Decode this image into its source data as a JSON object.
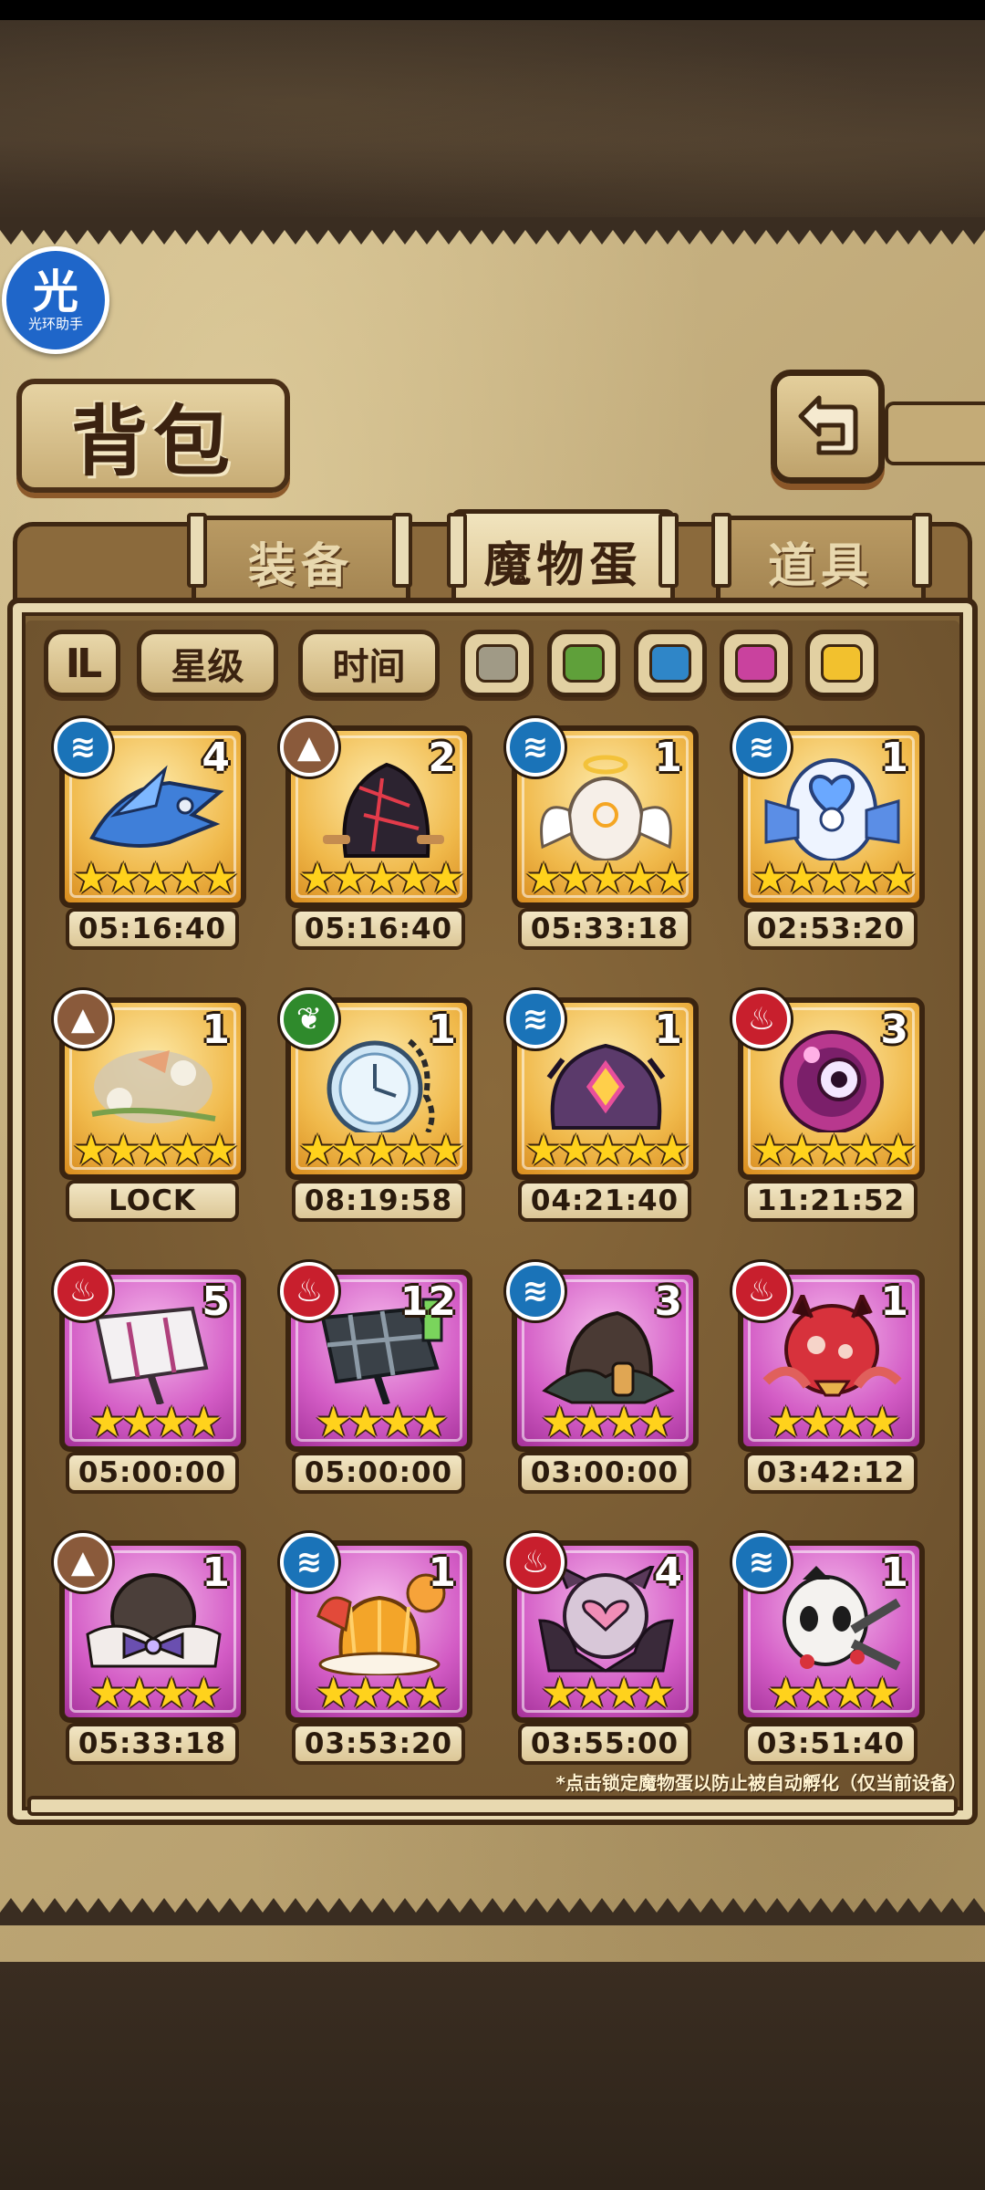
{
  "helper_badge": {
    "glyph": "光",
    "caption": "光环助手"
  },
  "header": {
    "title": "背包"
  },
  "tabs": [
    {
      "label": "装备",
      "active": false
    },
    {
      "label": "魔物蛋",
      "active": true
    },
    {
      "label": "道具",
      "active": false
    }
  ],
  "filters": {
    "sort_toggle_glyph": "IL",
    "star_label": "星级",
    "time_label": "时间",
    "color_swatches": [
      "#a09a86",
      "#5fa03a",
      "#2f86c8",
      "#c9429e",
      "#f2c12e"
    ]
  },
  "eggs": [
    {
      "element": "water",
      "count": "4",
      "stars": 5,
      "rarity": "gold",
      "timer": "05:16:40",
      "art": "blue-mecha-dragon"
    },
    {
      "element": "earth",
      "count": "2",
      "stars": 5,
      "rarity": "gold",
      "timer": "05:16:40",
      "art": "dark-hooded-egg"
    },
    {
      "element": "water",
      "count": "1",
      "stars": 5,
      "rarity": "gold",
      "timer": "05:33:18",
      "art": "winged-halo-egg"
    },
    {
      "element": "water",
      "count": "1",
      "stars": 5,
      "rarity": "gold",
      "timer": "02:53:20",
      "art": "heart-ribbon-egg"
    },
    {
      "element": "earth",
      "count": "1",
      "stars": 5,
      "rarity": "gold",
      "timer": "LOCK",
      "art": "flower-cloud-egg"
    },
    {
      "element": "wood",
      "count": "1",
      "stars": 5,
      "rarity": "gold",
      "timer": "08:19:58",
      "art": "pocket-watch-egg"
    },
    {
      "element": "water",
      "count": "1",
      "stars": 5,
      "rarity": "gold",
      "timer": "04:21:40",
      "art": "purple-eye-egg"
    },
    {
      "element": "fire",
      "count": "3",
      "stars": 5,
      "rarity": "gold",
      "timer": "11:21:52",
      "art": "pink-orb-egg"
    },
    {
      "element": "fire",
      "count": "5",
      "stars": 4,
      "rarity": "purple",
      "timer": "05:00:00",
      "art": "white-hammer-egg"
    },
    {
      "element": "fire",
      "count": "12",
      "stars": 4,
      "rarity": "purple",
      "timer": "05:00:00",
      "art": "plaid-hammer-egg"
    },
    {
      "element": "water",
      "count": "3",
      "stars": 4,
      "rarity": "purple",
      "timer": "03:00:00",
      "art": "brown-cloak-egg"
    },
    {
      "element": "fire",
      "count": "1",
      "stars": 4,
      "rarity": "purple",
      "timer": "03:42:12",
      "art": "red-octopus-egg"
    },
    {
      "element": "earth",
      "count": "1",
      "stars": 4,
      "rarity": "purple",
      "timer": "05:33:18",
      "art": "bow-tie-egg"
    },
    {
      "element": "water",
      "count": "1",
      "stars": 4,
      "rarity": "purple",
      "timer": "03:53:20",
      "art": "pudding-egg"
    },
    {
      "element": "fire",
      "count": "4",
      "stars": 4,
      "rarity": "purple",
      "timer": "03:55:00",
      "art": "bat-demon-egg"
    },
    {
      "element": "water",
      "count": "1",
      "stars": 4,
      "rarity": "purple",
      "timer": "03:51:40",
      "art": "panda-scissor-egg"
    }
  ],
  "footer_note": "*点击锁定魔物蛋以防止被自动孵化（仅当前设备）",
  "colors": {
    "water": "#1a73b8",
    "fire": "#c81f2d",
    "earth": "#8a5a3b",
    "wood": "#2f8a2c",
    "gold_frame": "#f0b94b",
    "purple_frame": "#d35cc5"
  }
}
